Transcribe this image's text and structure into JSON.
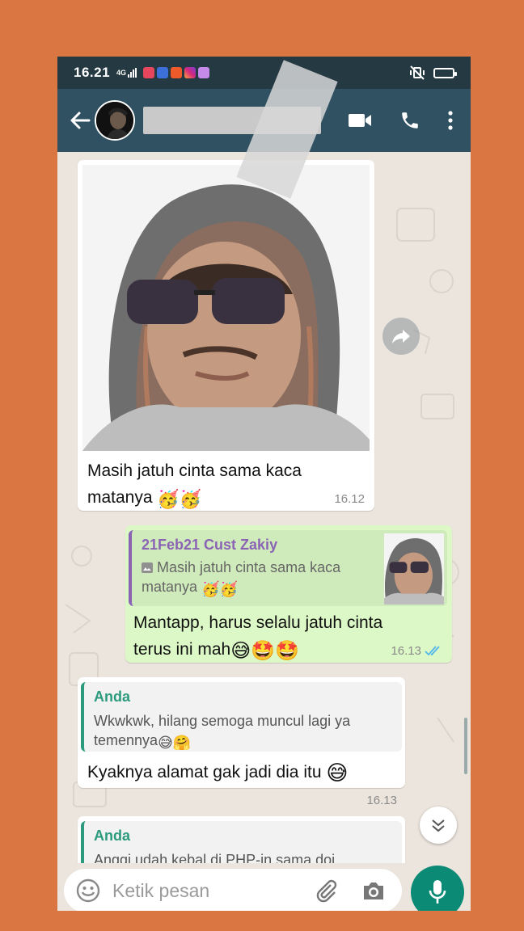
{
  "status_bar": {
    "time": "16.21",
    "network": "4G",
    "battery_color": "#f5d90a"
  },
  "app_bar": {
    "back_icon": "arrow-back-icon",
    "video_icon": "video-call-icon",
    "call_icon": "phone-icon",
    "menu_icon": "more-vert-icon"
  },
  "messages": {
    "photo_message": {
      "caption": "Masih jatuh cinta sama kaca matanya",
      "emojis": "🥳🥳",
      "time": "16.12"
    },
    "reply_out": {
      "quote_author": "21Feb21 Cust Zakiy",
      "quote_text_line1": "Masih jatuh cinta sama kaca",
      "quote_text_line2": "matanya",
      "quote_emojis": "🥳🥳",
      "text_line1": "Mantapp, harus selalu jatuh cinta",
      "text_line2": "terus ini mah",
      "text_emojis": "😅🤩🤩",
      "time": "16.13"
    },
    "reply_in": {
      "quote_author": "Anda",
      "quote_text_line1": "Wkwkwk, hilang semoga muncul lagi ya",
      "quote_text_line2": "temennya",
      "quote_emojis": "😅🤗",
      "text": "Kyaknya alamat gak jadi dia itu",
      "text_emoji": "😅",
      "time": "16.13"
    },
    "reply_partial": {
      "quote_author": "Anda",
      "quote_text_line1": "Anggi udah kebal di PHP-in sama doi"
    }
  },
  "input": {
    "placeholder": "Ketik pesan"
  },
  "colors": {
    "background": "#d97641",
    "app_bar": "#2f5162",
    "status_bar": "#243942",
    "outgoing_bubble": "#dcf8c6",
    "mic_button": "#0b8a76",
    "quote_accent_green": "#2b9a7d",
    "quote_accent_purple": "#8a63b5"
  }
}
